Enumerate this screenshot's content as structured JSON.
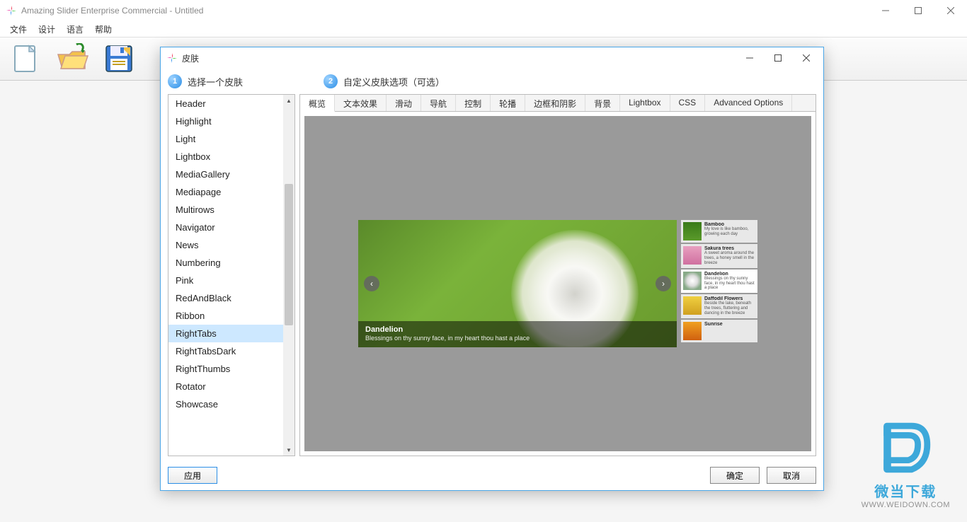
{
  "window": {
    "title": "Amazing Slider Enterprise Commercial - Untitled"
  },
  "menu": {
    "items": [
      "文件",
      "设计",
      "语言",
      "帮助"
    ]
  },
  "dialog": {
    "title": "皮肤",
    "step1": "选择一个皮肤",
    "step2": "自定义皮肤选项（可选）"
  },
  "skins": [
    "Header",
    "Highlight",
    "Light",
    "Lightbox",
    "MediaGallery",
    "Mediapage",
    "Multirows",
    "Navigator",
    "News",
    "Numbering",
    "Pink",
    "RedAndBlack",
    "Ribbon",
    "RightTabs",
    "RightTabsDark",
    "RightThumbs",
    "Rotator",
    "Showcase"
  ],
  "selectedSkin": "RightTabs",
  "tabs": [
    "概览",
    "文本效果",
    "滑动",
    "导航",
    "控制",
    "轮播",
    "边框和阴影",
    "背景",
    "Lightbox",
    "CSS",
    "Advanced Options"
  ],
  "slider": {
    "caption_title": "Dandelion",
    "caption_desc": "Blessings on thy sunny face, in my heart thou hast a place",
    "items": [
      {
        "title": "Bamboo",
        "desc": "My love is like bamboo, growing each day"
      },
      {
        "title": "Sakura trees",
        "desc": "A sweet aroma around the trees, a honey smell in the breeze"
      },
      {
        "title": "Dandelion",
        "desc": "Blessings on thy sunny face, in my heart thou hast a place"
      },
      {
        "title": "Daffodil Flowers",
        "desc": "Beside the lake, beneath the trees, fluttering and dancing in the breeze"
      },
      {
        "title": "Sunrise",
        "desc": ""
      }
    ]
  },
  "buttons": {
    "apply": "应用",
    "ok": "确定",
    "cancel": "取消"
  },
  "watermark": {
    "line1": "微当下载",
    "line2": "WWW.WEIDOWN.COM"
  }
}
